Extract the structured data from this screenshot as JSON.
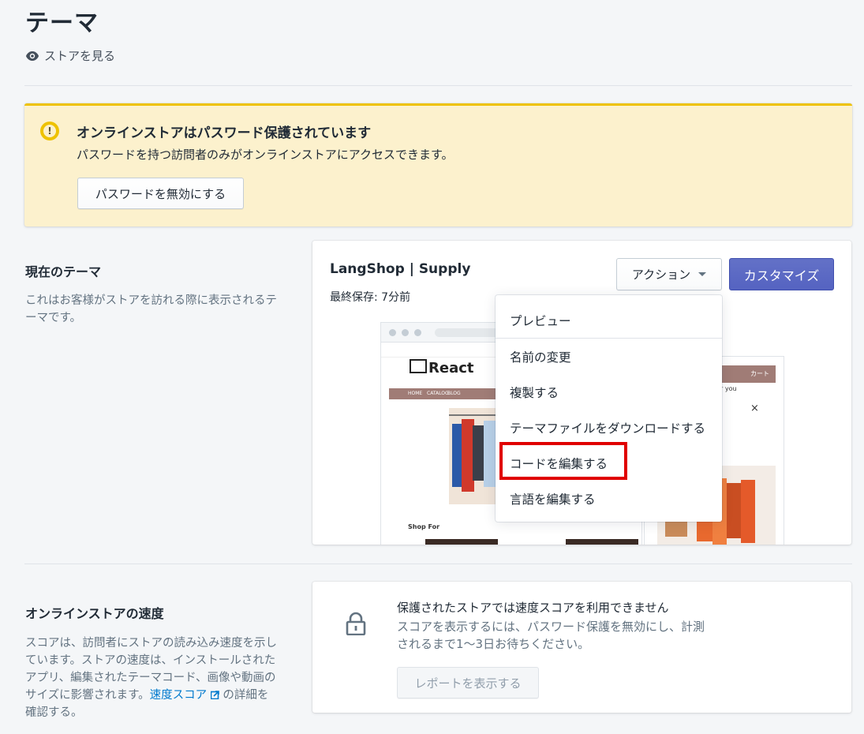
{
  "page": {
    "title": "テーマ",
    "view_store": "ストアを見る"
  },
  "banner": {
    "title": "オンラインストアはパスワード保護されています",
    "text": "パスワードを持つ訪問者のみがオンラインストアにアクセスできます。",
    "button": "パスワードを無効にする"
  },
  "current_theme": {
    "heading": "現在のテーマ",
    "description": "これはお客様がストアを訪れる際に表示されるテーマです。",
    "theme_name": "LangShop | Supply",
    "last_saved": "最終保存: 7分前",
    "actions_label": "アクション",
    "customize_label": "カスタマイズ",
    "menu": [
      "プレビュー",
      "名前の変更",
      "複製する",
      "テーマファイルをダウンロードする",
      "コードを編集する",
      "言語を編集する"
    ]
  },
  "preview": {
    "logo": "React",
    "cart": "カート",
    "shop_for": "Shop For",
    "nav": [
      "HOME",
      "CATALOG",
      "BLOG"
    ],
    "you_text": "r you",
    "close": "×"
  },
  "speed": {
    "heading": "オンラインストアの速度",
    "description_1": "スコアは、訪問者にストアの読み込み速度を示しています。ストアの速度は、インストールされたアプリ、編集されたテーマコード、画像や動画のサイズに影響されます。",
    "link": "速度スコア",
    "description_2": " の詳細を確認する。",
    "card_title": "保護されたストアでは速度スコアを利用できません",
    "card_text": "スコアを表示するには、パスワード保護を無効にし、計測されるまで1〜3日お待ちください。",
    "report_button": "レポートを表示する"
  },
  "colors": {
    "accent": "#5c6ac4",
    "warning": "#eec200",
    "highlight": "#e00000",
    "link": "#007ace"
  }
}
